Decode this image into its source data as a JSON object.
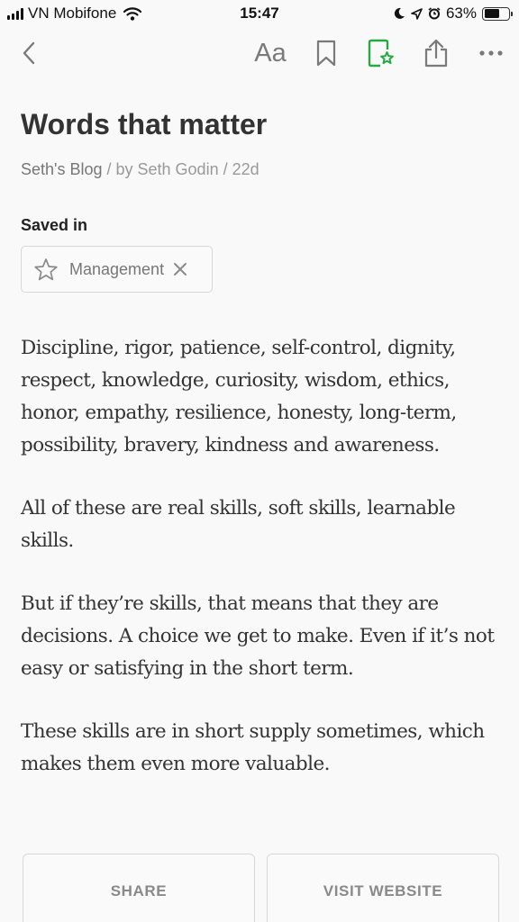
{
  "status_bar": {
    "carrier": "VN Mobifone",
    "time": "15:47",
    "battery": "63%",
    "battery_level": 0.63
  },
  "toolbar": {
    "back_icon": "chevron-left-icon",
    "font_label": "Aa",
    "bookmark_icon": "bookmark-icon",
    "saved_icon": "saved-collection-icon",
    "share_icon": "share-icon",
    "more_icon": "more-icon",
    "accent_color": "#27a943"
  },
  "article": {
    "title": "Words that matter",
    "source": "Seth's Blog",
    "byline": " / by Seth Godin / 22d",
    "saved_in_label": "Saved in",
    "tag": "Management",
    "paragraphs": [
      "Discipline, rigor, patience, self-control, dignity, respect, knowledge, curiosity, wisdom, ethics, honor, empathy, resilience, honesty, long-term, possibility, bravery, kindness and awareness.",
      "All of these are real skills, soft skills, learnable skills.",
      "But if they’re skills, that means that they are decisions. A choice we get to make. Even if it’s not easy or satisfying in the short term.",
      "These skills are in short supply sometimes, which makes them even more valuable."
    ]
  },
  "actions": {
    "share_label": "SHARE",
    "visit_label": "VISIT WEBSITE"
  }
}
